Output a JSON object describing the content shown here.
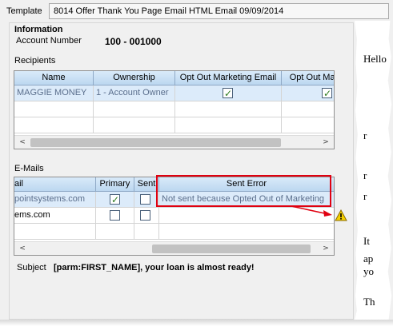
{
  "template": {
    "label": "Template",
    "value": "8014 Offer Thank You Page Email HTML Email 09/09/2014"
  },
  "information": {
    "title": "Information",
    "account_label": "Account Number",
    "account_value": "100 - 001000"
  },
  "recipients": {
    "title": "Recipients",
    "columns": [
      "Name",
      "Ownership",
      "Opt Out Marketing Email",
      "Opt Out Mar"
    ],
    "rows": [
      {
        "name": "MAGGIE MONEY",
        "ownership": "1 - Account Owner",
        "opt_out_marketing_email": true,
        "opt_out_mar": true
      }
    ]
  },
  "emails": {
    "title": "E-Mails",
    "columns": [
      "ail",
      "Primary",
      "Sent",
      "Sent Error"
    ],
    "rows": [
      {
        "email": "pointsystems.com",
        "primary": true,
        "sent": false,
        "sent_error": "Not sent because Opted Out of Marketing"
      },
      {
        "email": "ems.com",
        "primary": false,
        "sent": false,
        "sent_error": ""
      }
    ]
  },
  "subject": {
    "label": "Subject",
    "value": "[parm:FIRST_NAME], your loan is almost ready!"
  },
  "preview_fragments": [
    "Hello",
    "r",
    "r",
    "r",
    "It",
    "ap",
    "yo",
    "Th"
  ],
  "scroll": {
    "left_arrow": "<",
    "right_arrow": ">"
  },
  "icons": {
    "warning": "warning-icon",
    "arrow": "red-arrow"
  },
  "colors": {
    "highlight": "#e00010",
    "header": "#bcd7f0",
    "selected_row": "#dcebfa"
  }
}
